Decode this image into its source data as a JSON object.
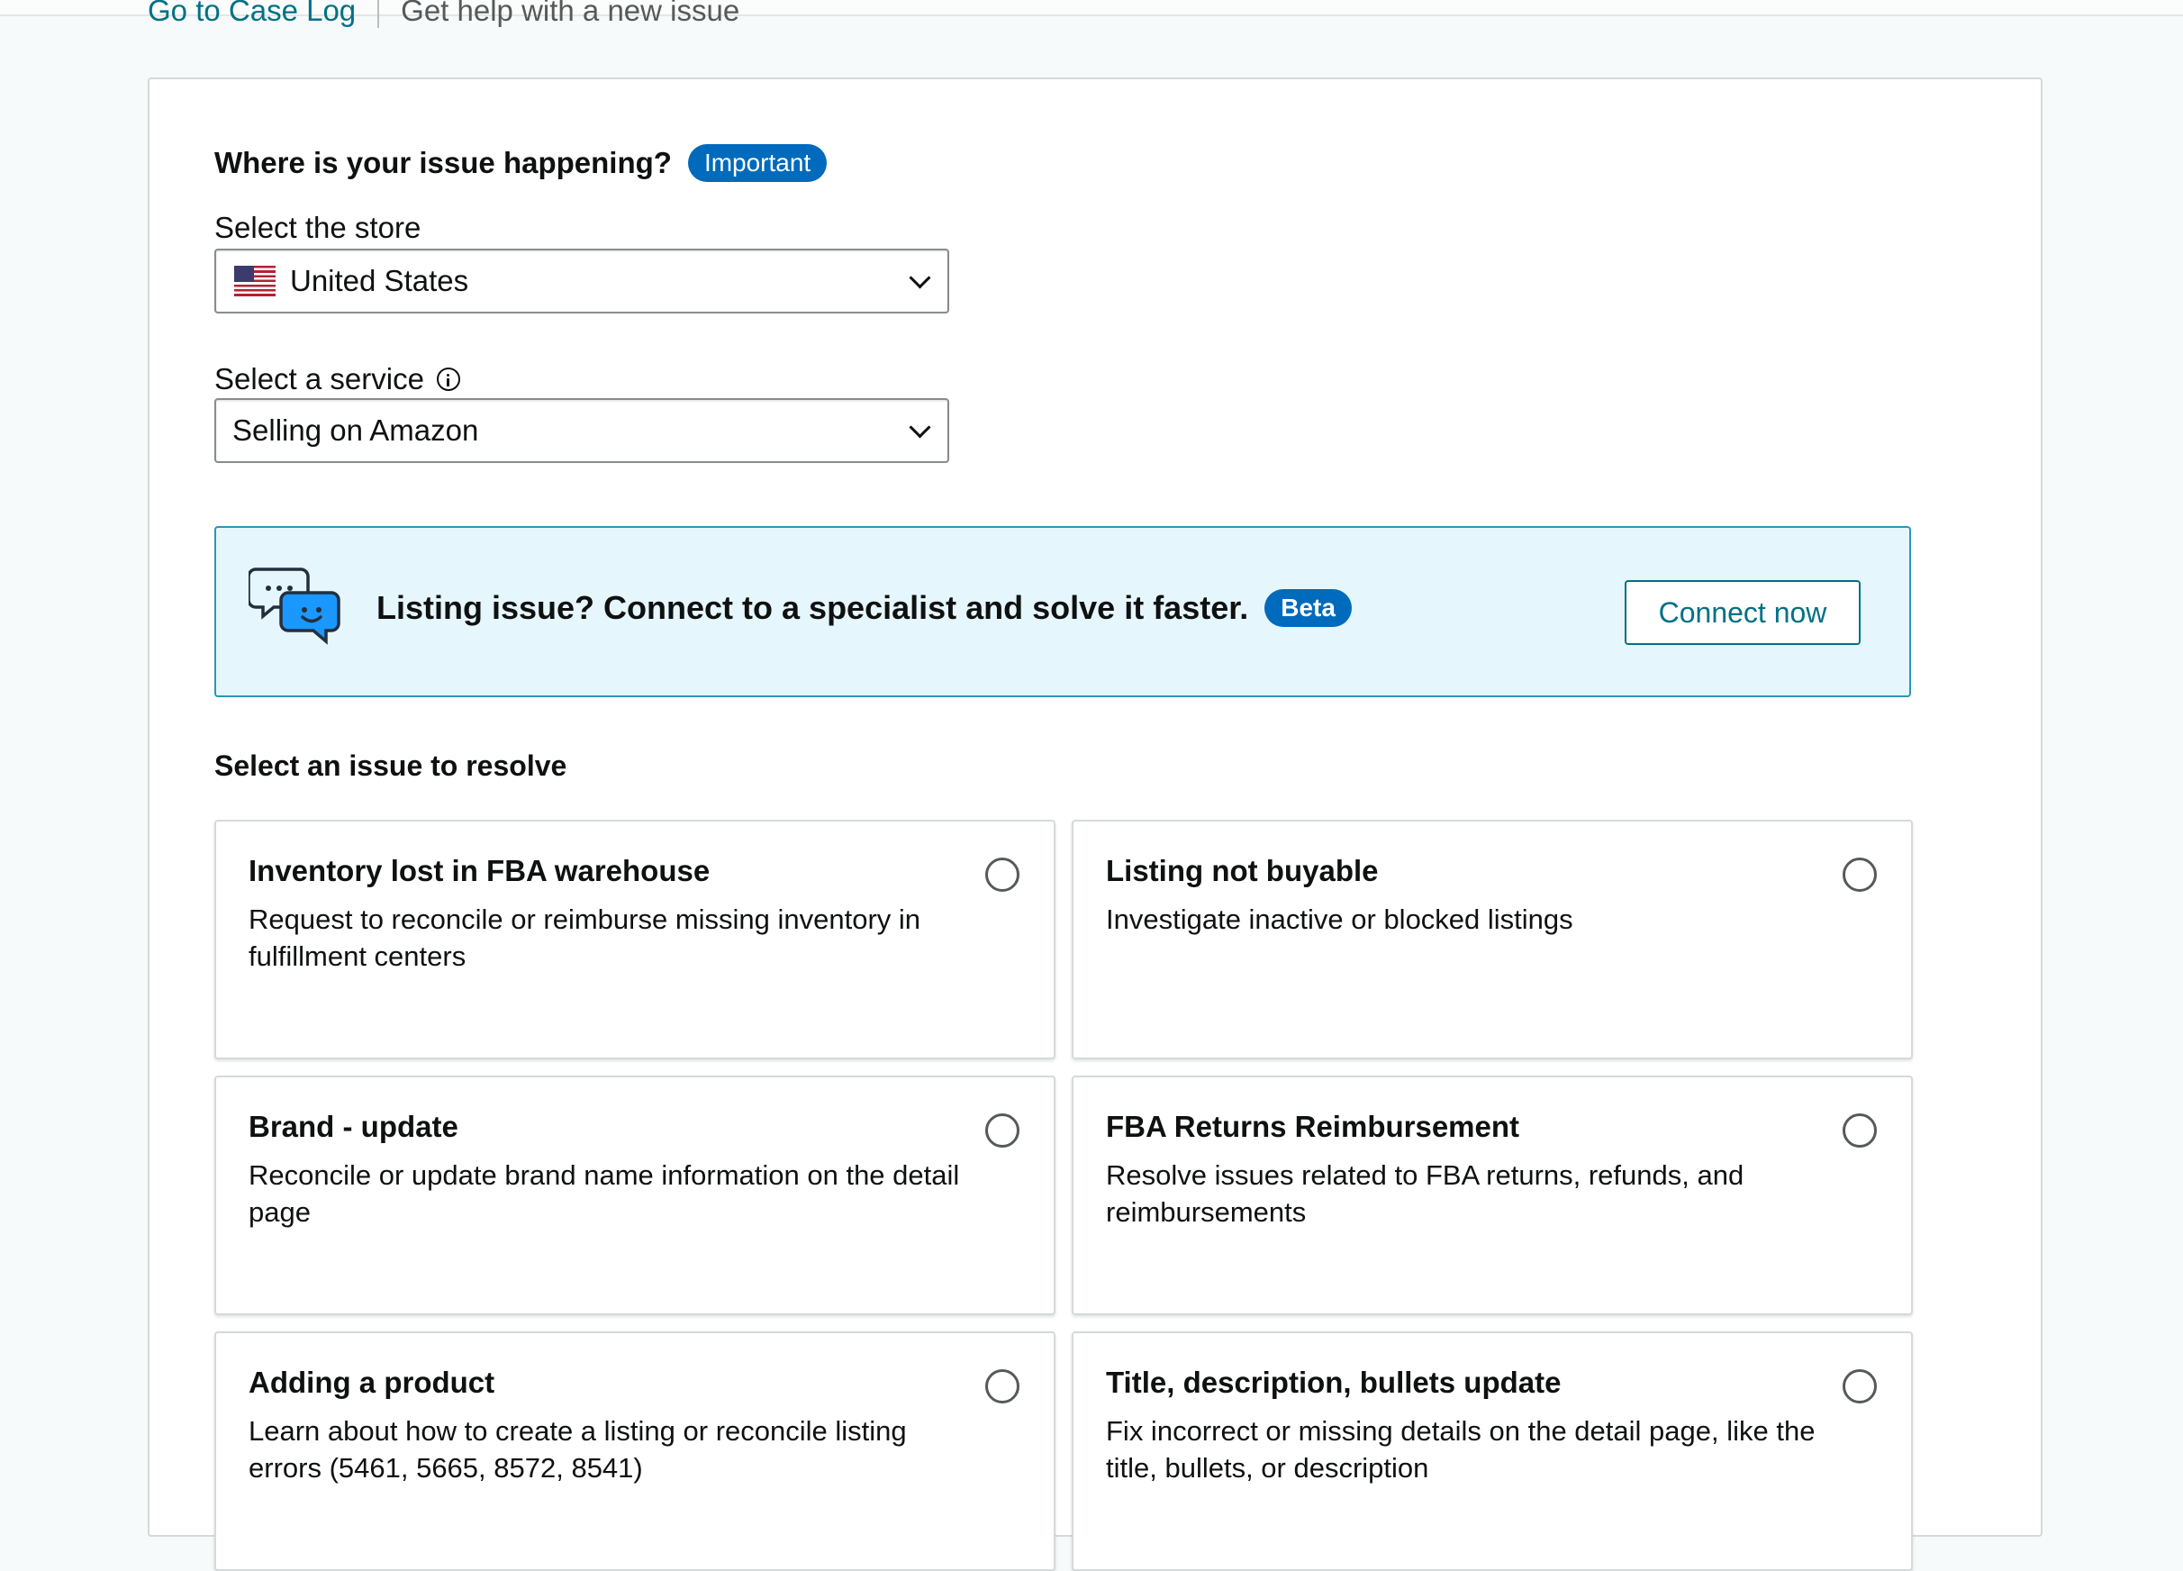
{
  "breadcrumb": {
    "case_log_link": "Go to Case Log",
    "current": "Get help with a new issue"
  },
  "question": {
    "title": "Where is your issue happening?",
    "badge": "Important"
  },
  "store": {
    "label": "Select the store",
    "value": "United States",
    "flag_icon": "us-flag-icon"
  },
  "service": {
    "label": "Select a service",
    "value": "Selling on Amazon"
  },
  "banner": {
    "text": "Listing issue? Connect to a specialist and solve it faster.",
    "badge": "Beta",
    "button": "Connect now"
  },
  "issues": {
    "heading": "Select an issue to resolve",
    "items": [
      {
        "title": "Inventory lost in FBA warehouse",
        "description": "Request to reconcile or reimburse missing inventory in fulfillment centers",
        "selected": false
      },
      {
        "title": "Listing not buyable",
        "description": "Investigate inactive or blocked listings",
        "selected": false
      },
      {
        "title": "Brand - update",
        "description": "Reconcile or update brand name information on the detail page",
        "selected": false
      },
      {
        "title": "FBA Returns Reimbursement",
        "description": "Resolve issues related to FBA returns, refunds, and reimbursements",
        "selected": false
      },
      {
        "title": "Adding a product",
        "description": "Learn about how to create a listing or reconcile listing errors (5461, 5665, 8572, 8541)",
        "selected": false
      },
      {
        "title": "Title, description, bullets update",
        "description": "Fix incorrect or missing details on the detail page, like the title, bullets, or description",
        "selected": false
      }
    ]
  },
  "colors": {
    "link": "#007185",
    "badge": "#006abc",
    "banner_bg": "#e6f6fd",
    "banner_border": "#2b95b9"
  }
}
